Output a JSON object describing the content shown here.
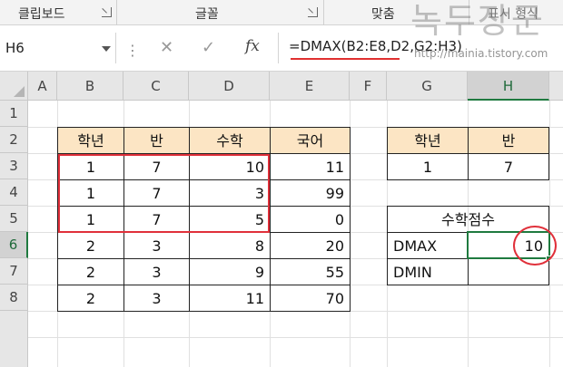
{
  "ribbon": {
    "groups": [
      {
        "label": "클립보드"
      },
      {
        "label": "글꼴"
      },
      {
        "label": "맞춤"
      },
      {
        "label": "표시 형식"
      }
    ]
  },
  "watermark": {
    "title": "녹두장군",
    "url": "http://mainia.tistory.com"
  },
  "formula_bar": {
    "name_box": "H6",
    "cancel_icon": "✕",
    "confirm_icon": "✓",
    "fx_label": "fx",
    "formula": "=DMAX(B2:E8,D2,G2:H3)"
  },
  "columns": [
    "A",
    "B",
    "C",
    "D",
    "E",
    "F",
    "G",
    "H"
  ],
  "rows": [
    "1",
    "2",
    "3",
    "4",
    "5",
    "6",
    "7",
    "8"
  ],
  "main_table": {
    "headers": [
      "학년",
      "반",
      "수학",
      "국어"
    ],
    "rows": [
      [
        "1",
        "7",
        "10",
        "11"
      ],
      [
        "1",
        "7",
        "3",
        "99"
      ],
      [
        "1",
        "7",
        "5",
        "0"
      ],
      [
        "2",
        "3",
        "8",
        "20"
      ],
      [
        "2",
        "3",
        "9",
        "55"
      ],
      [
        "2",
        "3",
        "11",
        "70"
      ]
    ]
  },
  "criteria_table": {
    "headers": [
      "학년",
      "반"
    ],
    "values": [
      "1",
      "7"
    ]
  },
  "result_table": {
    "title": "수학점수",
    "rows": [
      {
        "label": "DMAX",
        "value": "10"
      },
      {
        "label": "DMIN",
        "value": ""
      }
    ]
  },
  "colors": {
    "header_fill": "#fce5c4",
    "highlight_red": "#e0303a",
    "selection_green": "#1f7a3f"
  }
}
